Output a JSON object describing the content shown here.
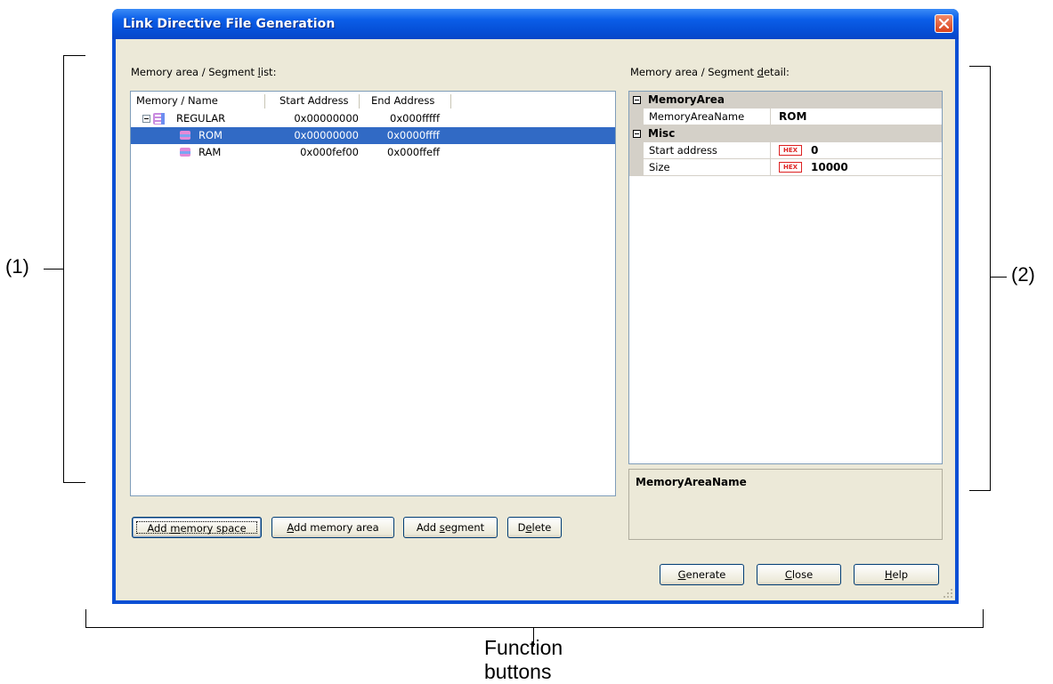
{
  "window": {
    "title": "Link Directive File Generation"
  },
  "left_panel": {
    "label_prefix": "Memory area / Segment ",
    "label_accel": "l",
    "label_suffix": "ist:",
    "columns": [
      "Memory / Name",
      "Start Address",
      "End Address"
    ],
    "rows": [
      {
        "name": "REGULAR",
        "start": "0x00000000",
        "end": "0x000fffff",
        "level": 0,
        "selected": false
      },
      {
        "name": "ROM",
        "start": "0x00000000",
        "end": "0x0000ffff",
        "level": 1,
        "selected": true
      },
      {
        "name": "RAM",
        "start": "0x000fef00",
        "end": "0x000ffeff",
        "level": 1,
        "selected": false
      }
    ],
    "buttons": {
      "add_memory_space_pre": "Add ",
      "add_memory_space_acc": "m",
      "add_memory_space_post": "emory space",
      "add_memory_area_pre": "",
      "add_memory_area_acc": "A",
      "add_memory_area_post": "dd memory area",
      "add_segment_pre": "Add ",
      "add_segment_acc": "s",
      "add_segment_post": "egment",
      "delete_pre": "D",
      "delete_acc": "e",
      "delete_post": "lete"
    }
  },
  "right_panel": {
    "label_prefix": "Memory area / Segment ",
    "label_accel": "d",
    "label_suffix": "etail:",
    "categories": [
      {
        "name": "MemoryArea"
      },
      {
        "name": "Misc"
      }
    ],
    "properties": {
      "memory_area_name_label": "MemoryAreaName",
      "memory_area_name_value": "ROM",
      "start_address_label": "Start address",
      "start_address_value": "0",
      "size_label": "Size",
      "size_value": "10000",
      "hex_badge": "HEX"
    },
    "description_title": "MemoryAreaName"
  },
  "bottom_buttons": {
    "generate_acc": "G",
    "generate_post": "enerate",
    "close_acc": "C",
    "close_post": "lose",
    "help_acc": "H",
    "help_post": "elp"
  },
  "annotations": {
    "left": "(1)",
    "right": "(2)",
    "bottom": "Function buttons"
  }
}
